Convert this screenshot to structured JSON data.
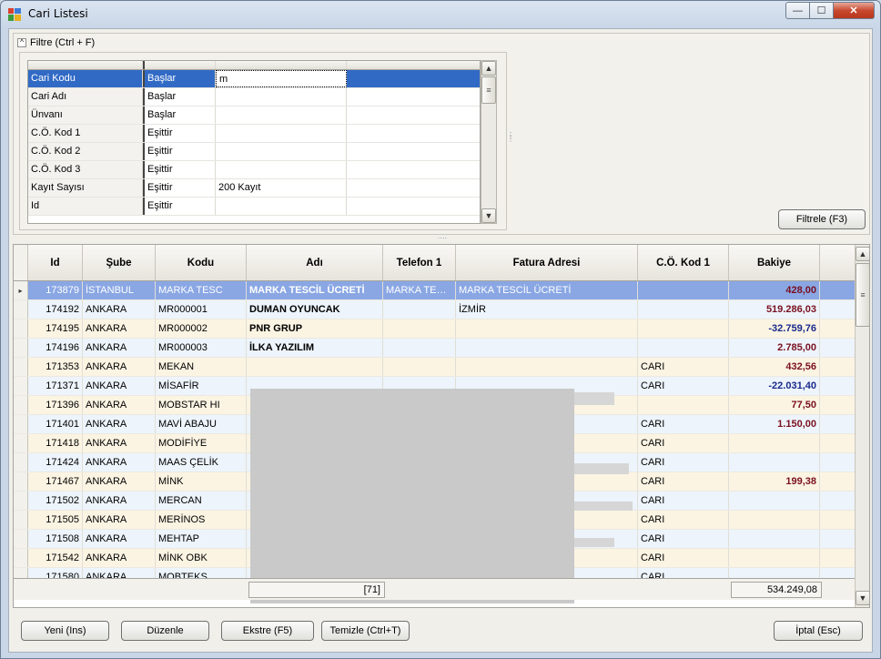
{
  "window": {
    "title": "Cari Listesi",
    "min_glyph": "—",
    "max_glyph": "☐",
    "close_glyph": "✕"
  },
  "filter": {
    "header": "Filtre (Ctrl + F)",
    "collapse_glyph": "^",
    "rows": [
      {
        "field": "Cari Kodu",
        "op": "Başlar",
        "value": "m",
        "extra": ""
      },
      {
        "field": "Cari Adı",
        "op": "Başlar",
        "value": "",
        "extra": ""
      },
      {
        "field": "Ünvanı",
        "op": "Başlar",
        "value": "",
        "extra": ""
      },
      {
        "field": "C.Ö. Kod 1",
        "op": "Eşittir",
        "value": "",
        "extra": ""
      },
      {
        "field": "C.Ö. Kod 2",
        "op": "Eşittir",
        "value": "",
        "extra": ""
      },
      {
        "field": "C.Ö. Kod 3",
        "op": "Eşittir",
        "value": "",
        "extra": ""
      },
      {
        "field": "Kayıt Sayısı",
        "op": "Eşittir",
        "value": "200 Kayıt",
        "extra": ""
      },
      {
        "field": "Id",
        "op": "Eşittir",
        "value": "",
        "extra": ""
      }
    ],
    "filter_button": "Filtrele (F3)"
  },
  "grid": {
    "columns": [
      "Id",
      "Şube",
      "Kodu",
      "Adı",
      "Telefon 1",
      "Fatura Adresi",
      "C.Ö. Kod 1",
      "Bakiye"
    ],
    "rows": [
      {
        "id": "173879",
        "sube": "İSTANBUL",
        "kodu": "MARKA TESC",
        "adi": "MARKA TESCİL ÜCRETİ",
        "tel": "MARKA TESCİL",
        "fatura": "MARKA TESCİL ÜCRETİ",
        "co": "",
        "bakiye": "428,00",
        "sign": "pos"
      },
      {
        "id": "174192",
        "sube": "ANKARA",
        "kodu": "MR000001",
        "adi": "DUMAN OYUNCAK",
        "tel": "",
        "fatura": "İZMİR",
        "co": "",
        "bakiye": "519.286,03",
        "sign": "pos"
      },
      {
        "id": "174195",
        "sube": "ANKARA",
        "kodu": "MR000002",
        "adi": "PNR GRUP",
        "tel": "",
        "fatura": "",
        "co": "",
        "bakiye": "-32.759,76",
        "sign": "neg"
      },
      {
        "id": "174196",
        "sube": "ANKARA",
        "kodu": "MR000003",
        "adi": "İLKA YAZILIM",
        "tel": "",
        "fatura": "",
        "co": "",
        "bakiye": "2.785,00",
        "sign": "pos"
      },
      {
        "id": "171353",
        "sube": "ANKARA",
        "kodu": "MEKAN",
        "adi": "",
        "tel": "",
        "fatura": "",
        "co": "CARI",
        "bakiye": "432,56",
        "sign": "pos"
      },
      {
        "id": "171371",
        "sube": "ANKARA",
        "kodu": "MİSAFİR",
        "adi": "",
        "tel": "",
        "fatura": "",
        "co": "CARI",
        "bakiye": "-22.031,40",
        "sign": "neg"
      },
      {
        "id": "171396",
        "sube": "ANKARA",
        "kodu": "MOBSTAR HI",
        "adi": "",
        "tel": "",
        "fatura": "",
        "co": "",
        "bakiye": "77,50",
        "sign": "pos"
      },
      {
        "id": "171401",
        "sube": "ANKARA",
        "kodu": "MAVİ ABAJU",
        "adi": "",
        "tel": "",
        "fatura": "",
        "co": "CARI",
        "bakiye": "1.150,00",
        "sign": "pos"
      },
      {
        "id": "171418",
        "sube": "ANKARA",
        "kodu": "MODİFİYE",
        "adi": "",
        "tel": "",
        "fatura": "",
        "co": "CARI",
        "bakiye": "",
        "sign": "pos"
      },
      {
        "id": "171424",
        "sube": "ANKARA",
        "kodu": "MAAS ÇELİK",
        "adi": "",
        "tel": "",
        "fatura": "",
        "co": "CARI",
        "bakiye": "",
        "sign": "pos"
      },
      {
        "id": "171467",
        "sube": "ANKARA",
        "kodu": "MİNK",
        "adi": "",
        "tel": "",
        "fatura": "",
        "co": "CARI",
        "bakiye": "199,38",
        "sign": "pos"
      },
      {
        "id": "171502",
        "sube": "ANKARA",
        "kodu": "MERCAN",
        "adi": "",
        "tel": "",
        "fatura": "",
        "co": "CARI",
        "bakiye": "",
        "sign": "pos"
      },
      {
        "id": "171505",
        "sube": "ANKARA",
        "kodu": "MERİNOS",
        "adi": "",
        "tel": "",
        "fatura": "",
        "co": "CARI",
        "bakiye": "",
        "sign": "pos"
      },
      {
        "id": "171508",
        "sube": "ANKARA",
        "kodu": "MEHTAP",
        "adi": "",
        "tel": "",
        "fatura": "",
        "co": "CARI",
        "bakiye": "",
        "sign": "pos"
      },
      {
        "id": "171542",
        "sube": "ANKARA",
        "kodu": "MİNK OBK",
        "adi": "",
        "tel": "",
        "fatura": "",
        "co": "CARI",
        "bakiye": "",
        "sign": "pos"
      },
      {
        "id": "171580",
        "sube": "ANKARA",
        "kodu": "MOBTEKS",
        "adi": "",
        "tel": "",
        "fatura": "",
        "co": "CARI",
        "bakiye": "",
        "sign": "pos"
      }
    ],
    "footer_count": "[71]",
    "footer_total": "534.249,08",
    "row_indicator": "▸"
  },
  "buttons": {
    "new": "Yeni (Ins)",
    "edit": "Düzenle",
    "extract": "Ekstre (F5)",
    "clear": "Temizle (Ctrl+T)",
    "cancel": "İptal (Esc)"
  },
  "colors": {
    "positive_balance": "#7a1020",
    "negative_balance": "#1a2a8c",
    "selection": "#316ac5"
  }
}
